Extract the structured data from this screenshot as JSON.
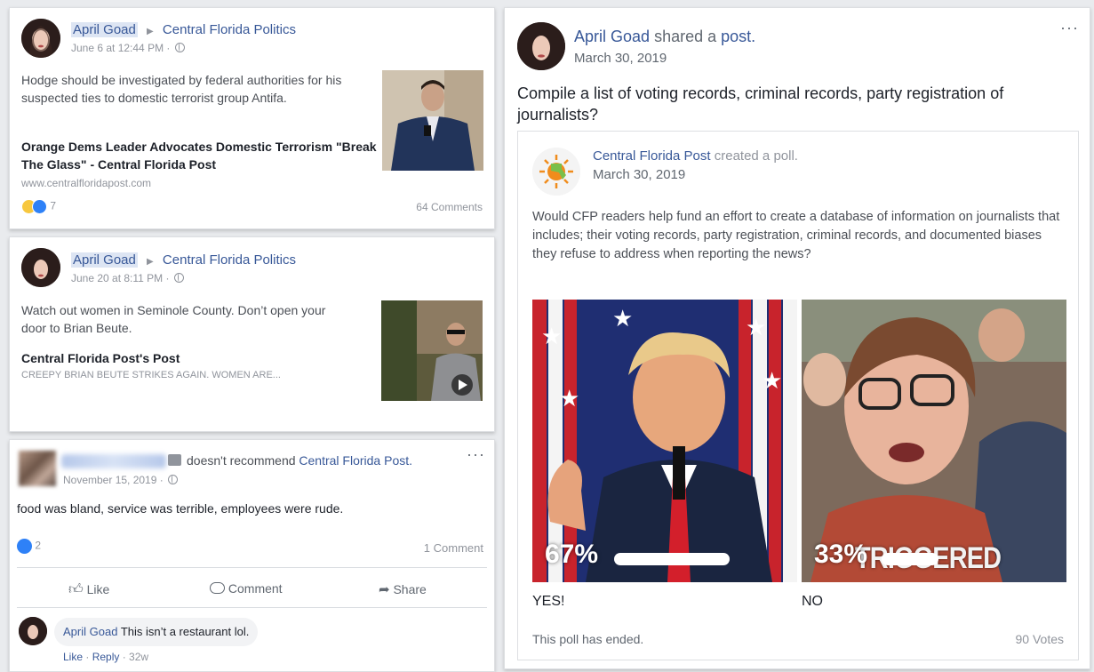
{
  "post1": {
    "author": "April Goad",
    "group": "Central Florida Politics",
    "time": "June 6 at 12:44 PM ·",
    "text": "Hodge should be investigated by federal authorities for his suspected ties to domestic terrorist group Antifa.",
    "link_title": "Orange Dems Leader Advocates Domestic Terrorism \"Break The Glass\" - Central Florida Post",
    "link_domain": "www.centralfloridapost.com",
    "reaction_count": "7",
    "comments": "64 Comments"
  },
  "post2": {
    "author": "April Goad",
    "group": "Central Florida Politics",
    "time": "June 20 at 8:11 PM ·",
    "text": "Watch out women in Seminole County. Don’t open your door to Brian Beute.",
    "link_title": "Central Florida Post's Post",
    "link_subtitle": "CREEPY BRIAN BEUTE STRIKES AGAIN. WOMEN ARE..."
  },
  "review": {
    "action": "doesn't recommend",
    "page": "Central Florida Post.",
    "time": "November 15, 2019 ·",
    "text": "food was bland, service was terrible, employees were rude.",
    "like_count": "2",
    "comments": "1 Comment",
    "like_label": "Like",
    "comment_label": "Comment",
    "share_label": "Share",
    "reply": {
      "author": "April Goad",
      "text": "This isn’t a restaurant lol.",
      "like": "Like",
      "reply": "Reply",
      "age": "32w"
    }
  },
  "shared": {
    "author": "April Goad",
    "action": "shared a",
    "object": "post.",
    "time": "March 30, 2019",
    "text": "Compile a list of voting records, criminal records, party registration of journalists?",
    "inner": {
      "page": "Central Florida Post",
      "action": "created a poll.",
      "time": "March 30, 2019",
      "question": "Would CFP readers help fund an effort to create a database of information on journalists that includes; their voting records, party registration, criminal records, and documented biases they refuse to address when reporting the news?",
      "options": [
        {
          "label": "YES!",
          "percent": "67%",
          "share": 0.67
        },
        {
          "label": "NO",
          "percent": "33%",
          "share": 0.33
        }
      ],
      "overlay_text": "TRIGGERED",
      "status": "This poll has ended.",
      "votes": "90 Votes"
    }
  },
  "colors": {
    "link": "#385898",
    "like_blue": "#2e81f7",
    "haha_yellow": "#f7c73e"
  }
}
